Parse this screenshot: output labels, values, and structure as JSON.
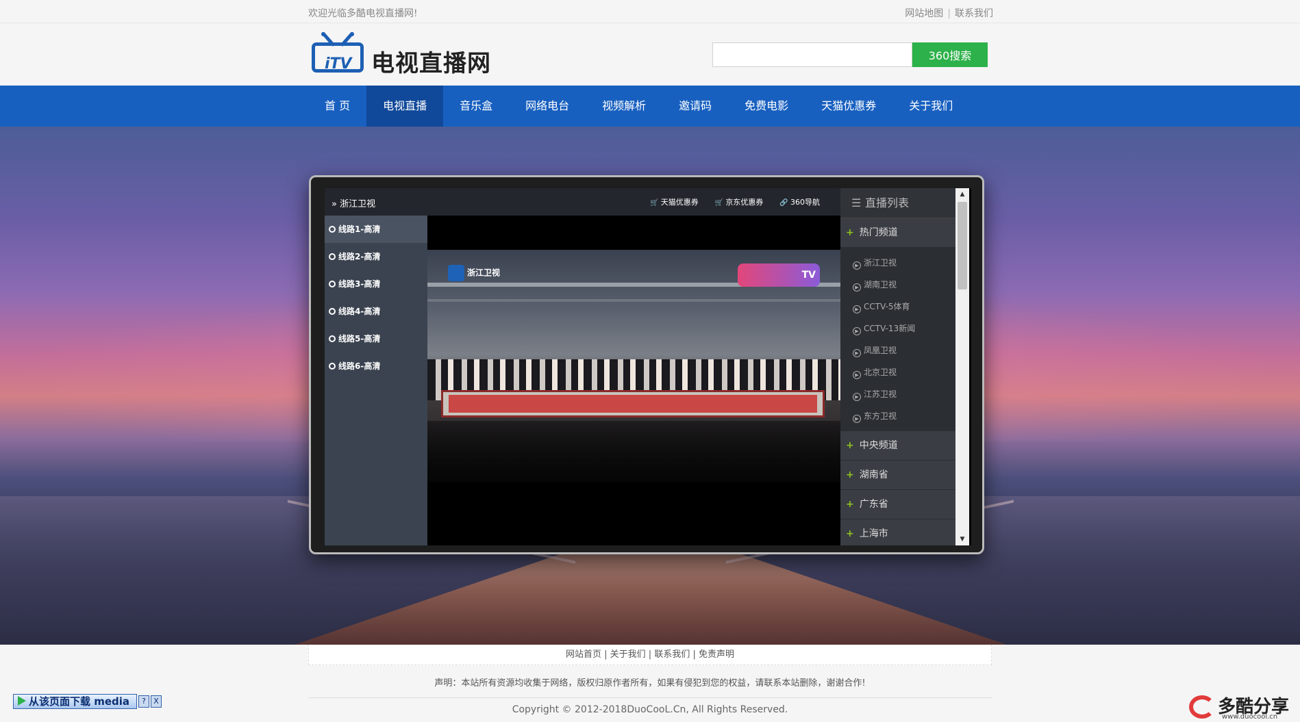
{
  "topbar": {
    "welcome": "欢迎光临多酷电视直播网!",
    "sitemap": "网站地图",
    "separator": "|",
    "contact": "联系我们"
  },
  "header": {
    "logo_text": "电视直播网",
    "logo_mark": "iTV",
    "search_placeholder": "",
    "search_button": "360搜索"
  },
  "nav": {
    "items": [
      "首 页",
      "电视直播",
      "音乐盒",
      "网络电台",
      "视频解析",
      "邀请码",
      "免费电影",
      "天猫优惠券",
      "关于我们"
    ],
    "active_index": 1
  },
  "player": {
    "channel": "» 浙江卫视",
    "top_links": [
      "天猫优惠券",
      "京东优惠券",
      "360导航"
    ],
    "lines": [
      "线路1-高清",
      "线路2-高清",
      "线路3-高清",
      "线路4-高清",
      "线路5-高清",
      "线路6-高清"
    ],
    "active_line": 0,
    "video_logo": "浙江卫视",
    "video_show_logo": "TV"
  },
  "playlist": {
    "title": "直播列表",
    "hot_group": "热门频道",
    "hot_channels": [
      "浙江卫视",
      "湖南卫视",
      "CCTV-5体育",
      "CCTV-13新闻",
      "凤凰卫视",
      "北京卫视",
      "江苏卫视",
      "东方卫视"
    ],
    "groups": [
      "中央频道",
      "湖南省",
      "广东省",
      "上海市"
    ]
  },
  "footer": {
    "links": "网站首页 | 关于我们 | 联系我们 | 免责声明",
    "declaration": "声明：本站所有资源均收集于网络，版权归原作者所有，如果有侵犯到您的权益，请联系本站删除，谢谢合作!",
    "copyright": "Copyright © 2012-2018DuoCooL.Cn, All Rights Reserved."
  },
  "media_bar": {
    "label": "从该页面下载 media",
    "help": "?",
    "close": "X"
  },
  "watermark": {
    "name": "多酷分享",
    "url": "www.duocool.cn"
  },
  "colors": {
    "nav_bg": "#1860c0",
    "nav_active": "#10499a",
    "search_button": "#2db14a",
    "logo_blue": "#1d5fb4",
    "plus_green": "#8fc31f"
  },
  "icons": {
    "line_icon": "circle-dot-icon",
    "cart_icon": "cart-icon",
    "link_icon": "link-icon",
    "list_icon": "list-icon",
    "plus_icon": "plus-icon",
    "play_icon": "play-circle-icon"
  }
}
